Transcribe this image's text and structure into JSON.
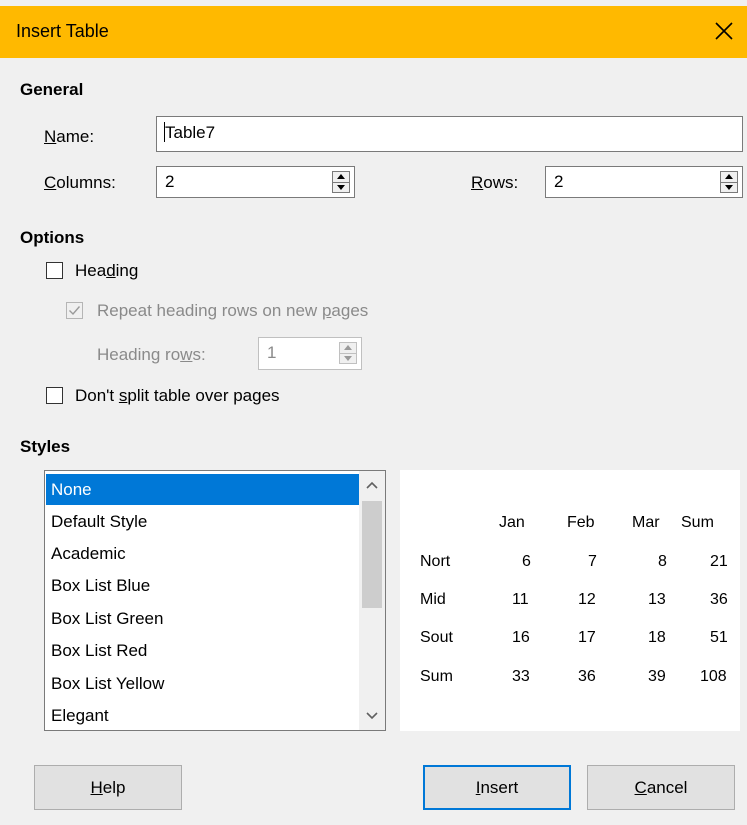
{
  "window": {
    "title": "Insert Table"
  },
  "general": {
    "heading": "General",
    "name_label_u": "N",
    "name_label_rest": "ame:",
    "name_value": "Table7",
    "columns_label_u": "C",
    "columns_label_rest": "olumns:",
    "columns_value": "2",
    "rows_label_u": "R",
    "rows_label_rest": "ows:",
    "rows_value": "2"
  },
  "options": {
    "heading": "Options",
    "heading_cb_pre": "Hea",
    "heading_cb_u": "d",
    "heading_cb_post": "ing",
    "heading_checked": false,
    "repeat_pre": "Repeat heading rows on new ",
    "repeat_u": "p",
    "repeat_post": "ages",
    "repeat_checked": true,
    "heading_rows_pre": "Heading ro",
    "heading_rows_u": "w",
    "heading_rows_post": "s:",
    "heading_rows_value": "1",
    "dont_split_pre": "Don't ",
    "dont_split_u": "s",
    "dont_split_post": "plit table over pages",
    "dont_split_checked": false
  },
  "styles": {
    "heading": "Styles",
    "items": [
      "None",
      "Default Style",
      "Academic",
      "Box List Blue",
      "Box List Green",
      "Box List Red",
      "Box List Yellow",
      "Elegant"
    ],
    "selected": "None"
  },
  "preview": {
    "headers": [
      "",
      "Jan",
      "Feb",
      "Mar",
      "Sum"
    ],
    "rows": [
      [
        "Nort",
        "6",
        "7",
        "8",
        "21"
      ],
      [
        "Mid",
        "11",
        "12",
        "13",
        "36"
      ],
      [
        "Sout",
        "16",
        "17",
        "18",
        "51"
      ],
      [
        "Sum",
        "33",
        "36",
        "39",
        "108"
      ]
    ]
  },
  "buttons": {
    "help_u": "H",
    "help_rest": "elp",
    "insert_u": "I",
    "insert_rest": "nsert",
    "cancel_u": "C",
    "cancel_rest": "ancel"
  },
  "colors": {
    "titlebar": "#ffb900",
    "selection": "#0078d7",
    "default_button_border": "#0078d7"
  }
}
